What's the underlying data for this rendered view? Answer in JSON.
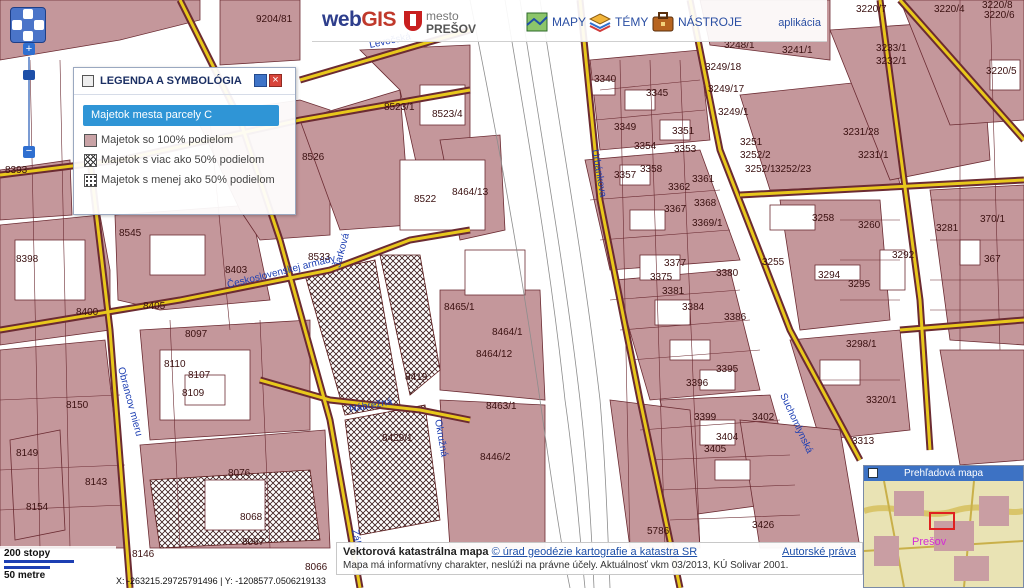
{
  "header": {
    "brand_web": "web",
    "brand_gis": "GIS",
    "city_top": "mesto",
    "city_name": "PREŠOV",
    "buttons": [
      {
        "label": "MAPY",
        "icon": "map-icon"
      },
      {
        "label": "TÉMY",
        "icon": "layers-icon"
      },
      {
        "label": "NÁSTROJE",
        "icon": "toolbox-icon"
      }
    ],
    "app_link": "aplikácia"
  },
  "legend": {
    "title": "LEGENDA A SYMBOLÓGIA",
    "active_layer": "Majetok mesta parcely C",
    "items": [
      {
        "label": "Majetok so 100% podielom",
        "style": "full"
      },
      {
        "label": "Majetok s viac ako 50% podielom",
        "style": "crosshatch"
      },
      {
        "label": "Majetok s menej ako 50% podielom",
        "style": "dotted"
      }
    ]
  },
  "info": {
    "title": "Vektorová katastrálna mapa",
    "source_link": "© úrad geodézie kartografie a katastra SR",
    "rights_link": "Autorské práva",
    "note": "Mapa má informatívny charakter, neslúži na právne účely. Aktuálnosť vkm 03/2013, KÚ Solivar 2001."
  },
  "scale": {
    "top": "200 stopy",
    "bottom": "50 metre"
  },
  "coords": "X: -263215.29725791496 | Y: -1208577.0506219133",
  "overview": {
    "title": "Prehľadová mapa",
    "city_label": "Prešov"
  },
  "streets": [
    "Levočská",
    "Urbánkova",
    "Československej armády",
    "Jarková",
    "Nábrežná",
    "Okružná",
    "Obrancov mieru",
    "Záhradná",
    "Suchomlynská"
  ],
  "parcels": [
    "9204/81",
    "3220/7",
    "3220/4",
    "3220/8",
    "3220/6",
    "3220/5",
    "3233/1",
    "3232/1",
    "3248/1",
    "3241/1",
    "3340",
    "3249/18",
    "3345",
    "3249/17",
    "3349",
    "3249/1",
    "3354",
    "3351",
    "3353",
    "3252/1",
    "3252/2",
    "3252/23",
    "3251",
    "3357",
    "3358",
    "3361",
    "3362",
    "3231/28",
    "3231/1",
    "3367",
    "3368",
    "3369/1",
    "3377",
    "3380",
    "3375",
    "3381",
    "3384",
    "3386",
    "3255",
    "3258",
    "3260",
    "3294",
    "3295",
    "3292",
    "3281",
    "370/1",
    "367",
    "3298/1",
    "3320/1",
    "3313",
    "3395",
    "3396",
    "3399",
    "3402",
    "3404",
    "3405",
    "3426",
    "8523/1",
    "8523/4",
    "8526",
    "8522",
    "8464/13",
    "8533",
    "8545",
    "8398",
    "8403",
    "8405",
    "8400",
    "8097",
    "8110",
    "8107",
    "8109",
    "8150",
    "8419",
    "8465/1",
    "8464/1",
    "8464/12",
    "8463/1",
    "8429/1",
    "8446/2",
    "8143",
    "8149",
    "8154",
    "8076",
    "8068",
    "8067",
    "8146",
    "8393",
    "8066",
    "5786"
  ]
}
